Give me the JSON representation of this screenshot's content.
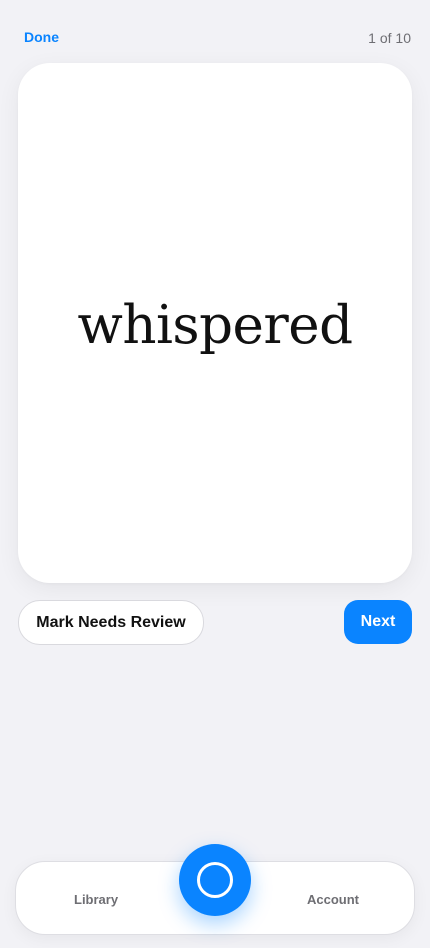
{
  "header": {
    "done_label": "Done",
    "progress": "1 of 10"
  },
  "card": {
    "word": "whispered"
  },
  "actions": {
    "review_label": "Mark Needs Review",
    "next_label": "Next"
  },
  "tabbar": {
    "library_label": "Library",
    "account_label": "Account",
    "center_icon": "circle-ring-icon"
  },
  "colors": {
    "accent": "#0a84ff",
    "background": "#f2f2f6",
    "card": "#ffffff",
    "muted_text": "#6e6e73"
  }
}
